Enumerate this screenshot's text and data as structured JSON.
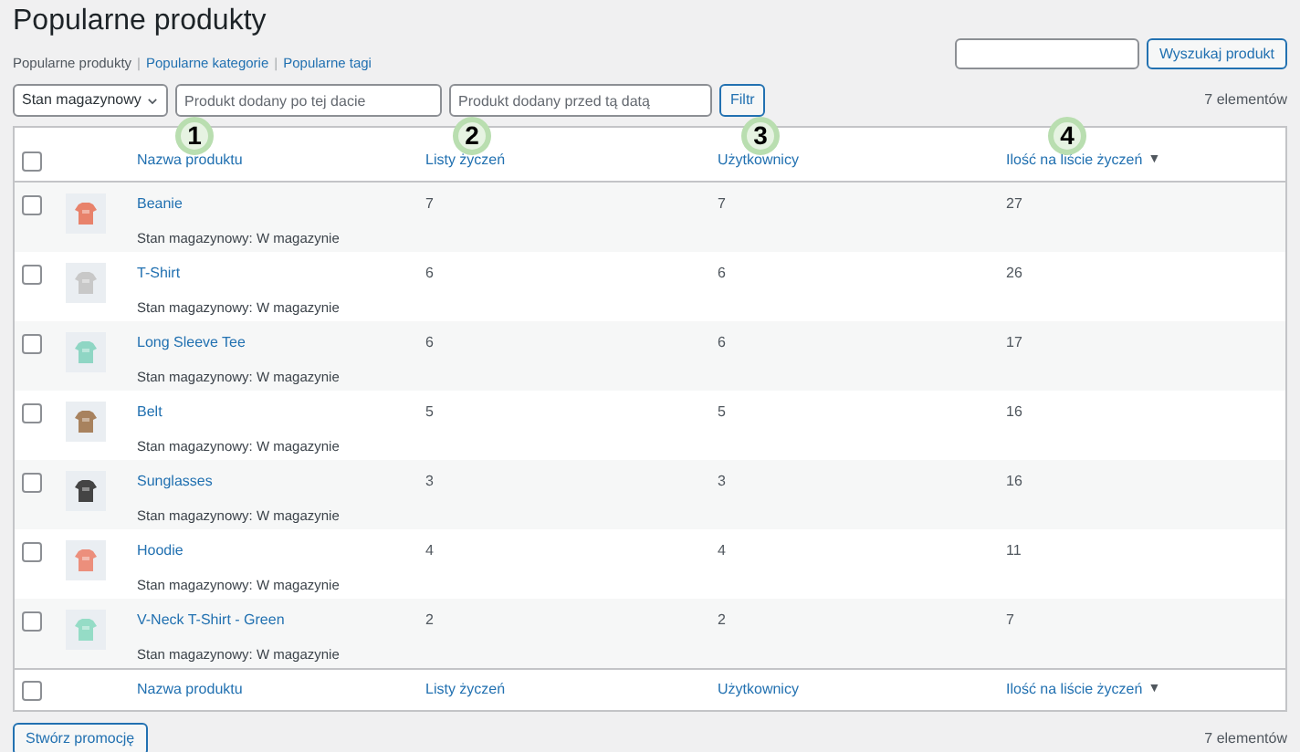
{
  "title": "Popularne produkty",
  "subnav_separator": "|",
  "subnav": [
    {
      "label": "Popularne produkty",
      "selected": true
    },
    {
      "label": "Popularne kategorie",
      "selected": false
    },
    {
      "label": "Popularne tagi",
      "selected": false
    }
  ],
  "search": {
    "button": "Wyszukaj produkt"
  },
  "filters": {
    "stock_select": "Stan magazynowy",
    "after_date": {
      "placeholder": "Produkt dodany po tej dacie"
    },
    "before_date": {
      "placeholder": "Produkt dodany przed tą datą"
    },
    "filter_button": "Filtr"
  },
  "count_top": "7 elementów",
  "table": {
    "select_all_checked": false,
    "columns": [
      {
        "label": "Nazwa produktu"
      },
      {
        "label": "Listy życzeń"
      },
      {
        "label": "Użytkownicy"
      },
      {
        "label": "Ilość na liście życzeń",
        "sort_arrow": "▼"
      }
    ],
    "rows": [
      {
        "checked": false,
        "color": "#e8826b",
        "name": "Beanie",
        "stock": "Stan magazynowy: W magazynie",
        "wishlists": "7",
        "users": "7",
        "quantity": "27"
      },
      {
        "checked": false,
        "color": "#c8c8c8",
        "name": "T-Shirt",
        "stock": "Stan magazynowy: W magazynie",
        "wishlists": "6",
        "users": "6",
        "quantity": "26"
      },
      {
        "checked": false,
        "color": "#8fd6c4",
        "name": "Long Sleeve Tee",
        "stock": "Stan magazynowy: W magazynie",
        "wishlists": "6",
        "users": "6",
        "quantity": "17"
      },
      {
        "checked": false,
        "color": "#a8825e",
        "name": "Belt",
        "stock": "Stan magazynowy: W magazynie",
        "wishlists": "5",
        "users": "5",
        "quantity": "16"
      },
      {
        "checked": false,
        "color": "#444444",
        "name": "Sunglasses",
        "stock": "Stan magazynowy: W magazynie",
        "wishlists": "3",
        "users": "3",
        "quantity": "16"
      },
      {
        "checked": false,
        "color": "#ec8f7c",
        "name": "Hoodie",
        "stock": "Stan magazynowy: W magazynie",
        "wishlists": "4",
        "users": "4",
        "quantity": "11"
      },
      {
        "checked": false,
        "color": "#95dcc6",
        "name": "V-Neck T-Shirt - Green",
        "stock": "Stan magazynowy: W magazynie",
        "wishlists": "2",
        "users": "2",
        "quantity": "7"
      }
    ],
    "footer_checked": false,
    "footer_columns": [
      {
        "label": "Nazwa produktu"
      },
      {
        "label": "Listy życzeń"
      },
      {
        "label": "Użytkownicy"
      },
      {
        "label": "Ilość na liście życzeń",
        "sort_arrow": "▼"
      }
    ]
  },
  "promo_button": "Stwórz promocję",
  "count_bottom": "7 elementów",
  "callouts": [
    "1",
    "2",
    "3",
    "4"
  ]
}
